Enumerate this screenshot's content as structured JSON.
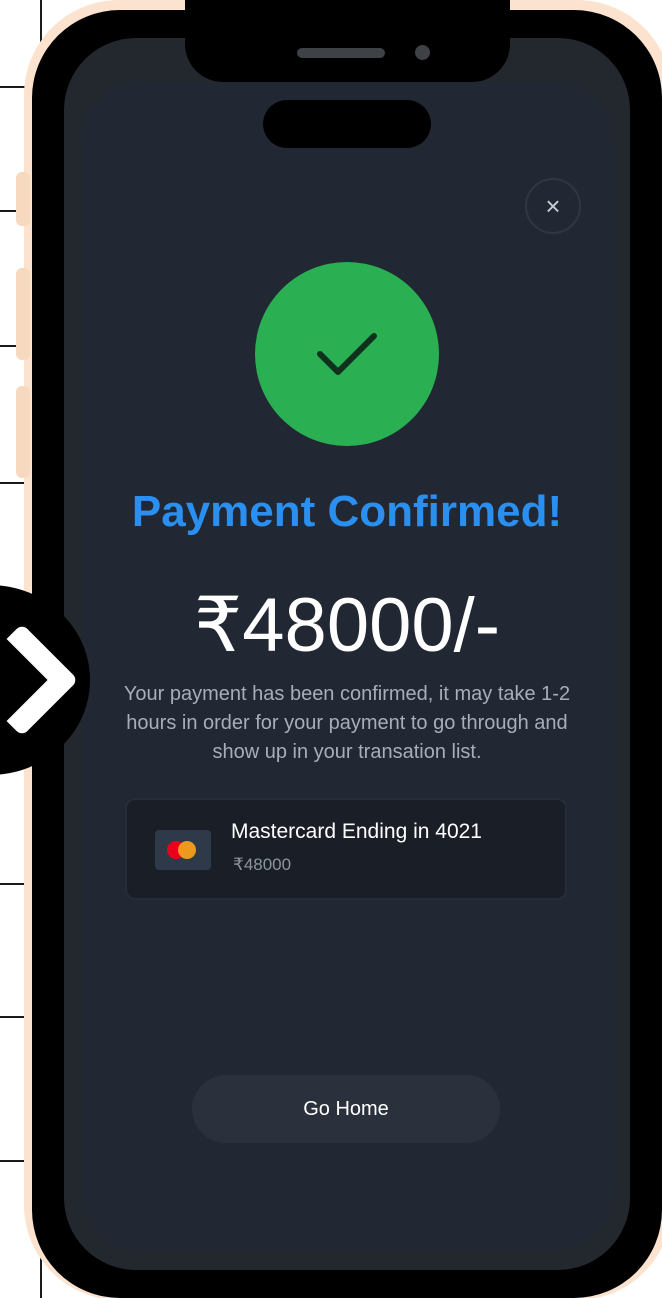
{
  "screen": {
    "close_label": "×",
    "title": "Payment Confirmed!",
    "amount": "₹48000/-",
    "description": "Your payment has been confirmed, it may take 1-2 hours in order for your payment to go through and show up in your transation list.",
    "card": {
      "title": "Mastercard Ending in 4021",
      "amount": "₹48000"
    },
    "go_home_label": "Go Home"
  },
  "icons": {
    "close": "close-icon",
    "success": "checkmark-icon",
    "card_brand": "mastercard-icon",
    "arrow": "chevron-right-icon"
  },
  "colors": {
    "accent": "#2b8ff0",
    "success": "#2ab052",
    "background": "#212833",
    "frame_accent": "#fbe3cf"
  }
}
